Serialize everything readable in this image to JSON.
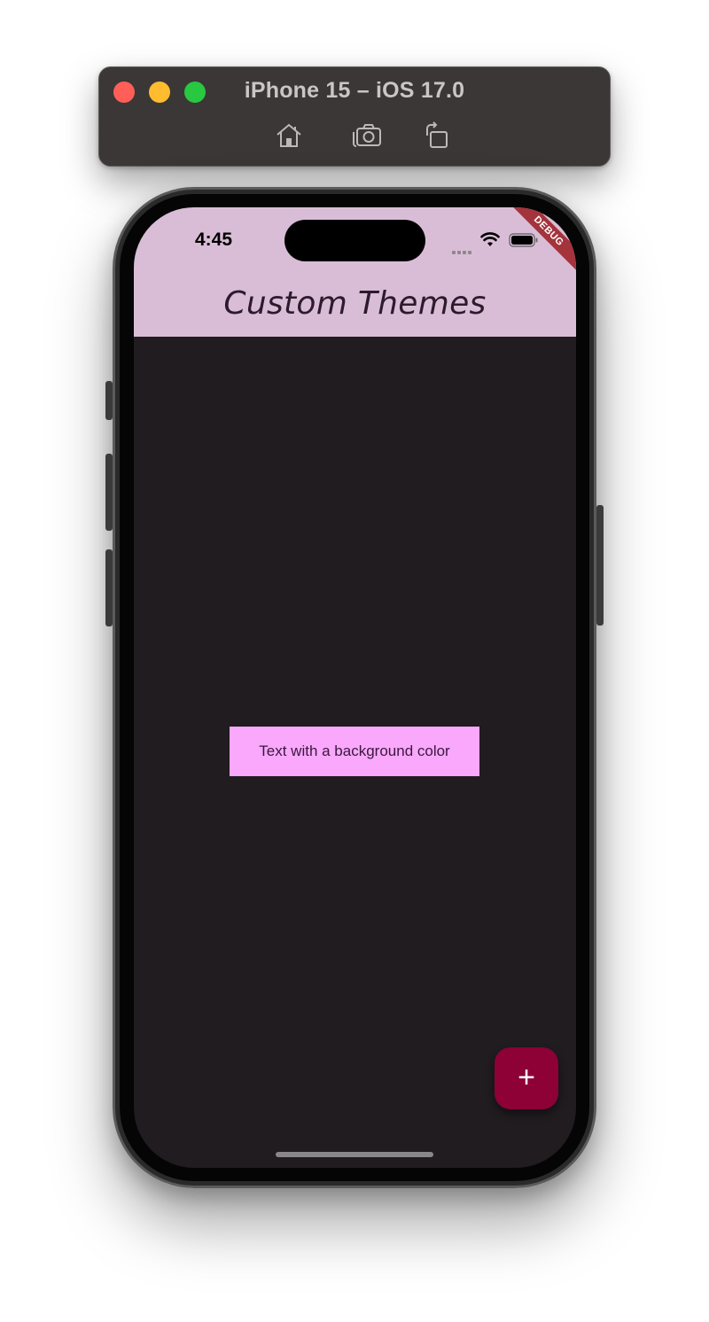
{
  "simulator": {
    "title": "iPhone 15 – iOS 17.0",
    "toolbar_icons": [
      "home-icon",
      "screenshot-camera-icon",
      "rotate-icon"
    ],
    "traffic_lights": [
      "#ff5f57",
      "#febc2e",
      "#28c840"
    ]
  },
  "status_bar": {
    "time": "4:45",
    "debug_banner": "DEBUG",
    "icons": [
      "cellular-signal-icon",
      "wifi-icon",
      "battery-icon"
    ]
  },
  "app": {
    "title": "Custom Themes",
    "body_text": "Text with a background color",
    "fab_label": "+",
    "colors": {
      "appbar": "#d9bdd6",
      "background": "#201c20",
      "text_background": "#f9a8fb",
      "fab": "#8d0136"
    }
  }
}
